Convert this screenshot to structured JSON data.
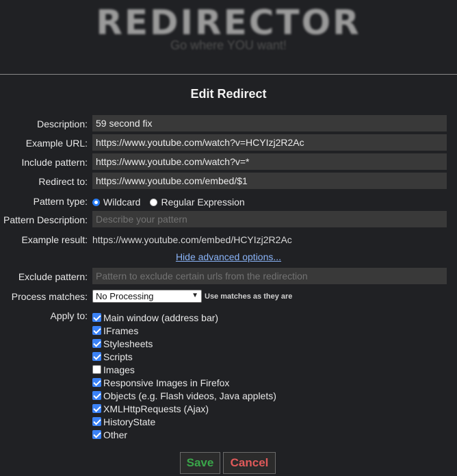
{
  "brand": {
    "logo": "REDIRECTOR",
    "tagline": "Go where YOU want!"
  },
  "title": "Edit Redirect",
  "form": {
    "description": {
      "label": "Description:",
      "value": "59 second fix"
    },
    "example_url": {
      "label": "Example URL:",
      "value": "https://www.youtube.com/watch?v=HCYIzj2R2Ac"
    },
    "include_pattern": {
      "label": "Include pattern:",
      "value": "https://www.youtube.com/watch?v=*"
    },
    "redirect_to": {
      "label": "Redirect to:",
      "value": "https://www.youtube.com/embed/$1"
    },
    "pattern_type": {
      "label": "Pattern type:",
      "options": [
        "Wildcard",
        "Regular Expression"
      ],
      "selected": "Wildcard"
    },
    "pattern_description": {
      "label": "Pattern Description:",
      "placeholder": "Describe your pattern"
    },
    "example_result": {
      "label": "Example result:",
      "value": "https://www.youtube.com/embed/HCYIzj2R2Ac"
    },
    "advanced_link": "Hide advanced options...",
    "exclude_pattern": {
      "label": "Exclude pattern:",
      "placeholder": "Pattern to exclude certain urls from the redirection"
    },
    "process_matches": {
      "label": "Process matches:",
      "selected": "No Processing",
      "hint": "Use matches as they are"
    },
    "apply_to": {
      "label": "Apply to:",
      "items": [
        {
          "label": "Main window (address bar)",
          "checked": true
        },
        {
          "label": "IFrames",
          "checked": true
        },
        {
          "label": "Stylesheets",
          "checked": true
        },
        {
          "label": "Scripts",
          "checked": true
        },
        {
          "label": "Images",
          "checked": false
        },
        {
          "label": "Responsive Images in Firefox",
          "checked": true
        },
        {
          "label": "Objects (e.g. Flash videos, Java applets)",
          "checked": true
        },
        {
          "label": "XMLHttpRequests (Ajax)",
          "checked": true
        },
        {
          "label": "HistoryState",
          "checked": true
        },
        {
          "label": "Other",
          "checked": true
        }
      ]
    }
  },
  "buttons": {
    "save": "Save",
    "cancel": "Cancel"
  },
  "colors": {
    "background": "#202124",
    "field": "#393939",
    "accent": "#3b82f6",
    "link": "#8ab4f8",
    "save": "#3aa64a",
    "cancel": "#e05a5a"
  }
}
